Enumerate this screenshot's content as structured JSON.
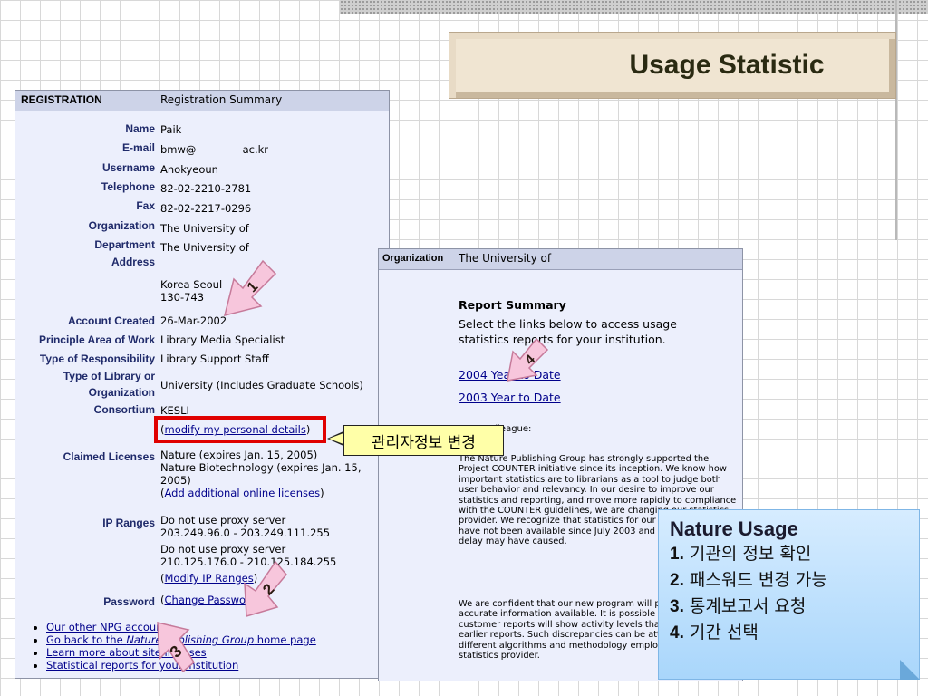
{
  "slide": {
    "title": "Usage Statistic"
  },
  "registration": {
    "header_left": "REGISTRATION",
    "header_right": "Registration Summary",
    "fields": {
      "name_label": "Name",
      "name": "Paik",
      "email_label": "E-mail",
      "email": "bmw@              ac.kr",
      "username_label": "Username",
      "username": "Anokyeoun",
      "telephone_label": "Telephone",
      "telephone": "82-02-2210-2781",
      "fax_label": "Fax",
      "fax": "82-02-2217-0296",
      "organization_label": "Organization",
      "organization": "The University of",
      "department_label": "Department",
      "department": "The University of",
      "address_label": "Address",
      "address_line1": "Korea Seoul",
      "address_line2": "130-743",
      "account_created_label": "Account Created",
      "account_created": "26-Mar-2002",
      "principle_area_label": "Principle Area of Work",
      "principle_area": "Library Media Specialist",
      "responsibility_label": "Type of Responsibility",
      "responsibility": "Library Support Staff",
      "library_type_label_1": "Type of Library or",
      "library_type_label_2": "Organization",
      "library_type": "University (Includes Graduate Schools)",
      "consortium_label": "Consortium",
      "consortium": "KESLI",
      "modify_details": "modify my personal details",
      "claimed_licenses_label": "Claimed Licenses",
      "license_1": "Nature (expires Jan. 15, 2005)",
      "license_2": "Nature Biotechnology (expires Jan. 15,",
      "license_2b": "2005)",
      "add_licenses": "Add additional online licenses",
      "ip_ranges_label": "IP Ranges",
      "ip_1a": "Do not use proxy server",
      "ip_1b": "203.249.96.0 - 203.249.111.255",
      "ip_2a": "Do not use proxy server",
      "ip_2b": "210.125.176.0 - 210.125.184.255",
      "modify_ip": "Modify IP Ranges",
      "password_label": "Password",
      "change_password": "Change Password"
    },
    "links": {
      "npg_accounts": "Our other NPG accounts",
      "back_prefix": "Go back to the ",
      "back_italic": "Nature Publishing Group",
      "back_suffix": " home page",
      "learn_more": "Learn more about site licenses",
      "statistical": "Statistical reports for your institution"
    }
  },
  "organization": {
    "header_left": "Organization",
    "header_right": "The University of",
    "report_summary": "Report Summary",
    "desc_1": "Select the links below to access usage",
    "desc_2": "statistics reports for your institution.",
    "link_2004": "2004 Year to Date",
    "link_2003": "2003 Year to Date",
    "colleague": "Dear Colleague:",
    "paragraph_1": "The Nature Publishing Group has strongly supported the Project COUNTER initiative since its inception. We know how important statistics are to librarians as a tool to judge both user behavior and relevancy. In our desire to improve our statistics and reporting, and move more rapidly to compliance with the COUNTER guidelines, we are changing our statistics provider. We recognize that statistics for our site license clients have not been available since July 2003 and apologize for any delay may have caused.",
    "paragraph_2": "We are confident that our new program will provide the most accurate information available. It is possible that some customer reports will show activity levels that differ from earlier reports. Such discrepancies can be attributed to the different algorithms and methodology employed in generating statistics provider."
  },
  "tooltip": "관리자정보 변경",
  "markers": [
    "1",
    "2",
    "3",
    "4"
  ],
  "note": {
    "title": "Nature Usage",
    "items": [
      {
        "num": "1.",
        "text": "기관의 정보 확인"
      },
      {
        "num": "2.",
        "text": "패스워드 변경 가능"
      },
      {
        "num": "3.",
        "text": "통계보고서 요청"
      },
      {
        "num": "4.",
        "text": "기간 선택"
      }
    ]
  },
  "colors": {
    "panel_bg": "#eceffc",
    "label_blue": "#1f2a6a",
    "highlight_red": "#e00000",
    "arrow_pink": "#f7c6dc",
    "note_blue": "#a9d6fb"
  }
}
